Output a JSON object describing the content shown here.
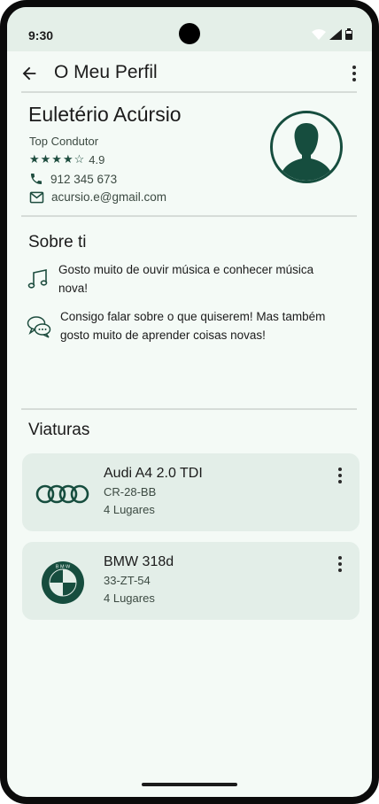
{
  "status_bar": {
    "time": "9:30"
  },
  "app_bar": {
    "title": "O Meu Perfil"
  },
  "profile": {
    "name": "Euletério Acúrsio",
    "role": "Top Condutor",
    "stars": "★★★★☆",
    "rating": "4.9",
    "phone": "912 345 673",
    "email": "acursio.e@gmail.com"
  },
  "about": {
    "title": "Sobre ti",
    "items": [
      {
        "icon": "music-note-icon",
        "text": "Gosto muito de ouvir música e conhecer música nova!"
      },
      {
        "icon": "chat-bubbles-icon",
        "text": "Consigo falar sobre o que quiserem! Mas também gosto muito de aprender coisas novas!"
      }
    ]
  },
  "vehicles": {
    "title": "Viaturas",
    "items": [
      {
        "logo": "audi-logo-icon",
        "name": "Audi A4 2.0 TDI",
        "plate": "CR-28-BB",
        "seats": "4 Lugares"
      },
      {
        "logo": "bmw-logo-icon",
        "name": "BMW 318d",
        "plate": "33-ZT-54",
        "seats": "4 Lugares"
      }
    ]
  },
  "colors": {
    "accent": "#164d3e",
    "background": "#f4faf6",
    "card": "#e3eee8"
  }
}
